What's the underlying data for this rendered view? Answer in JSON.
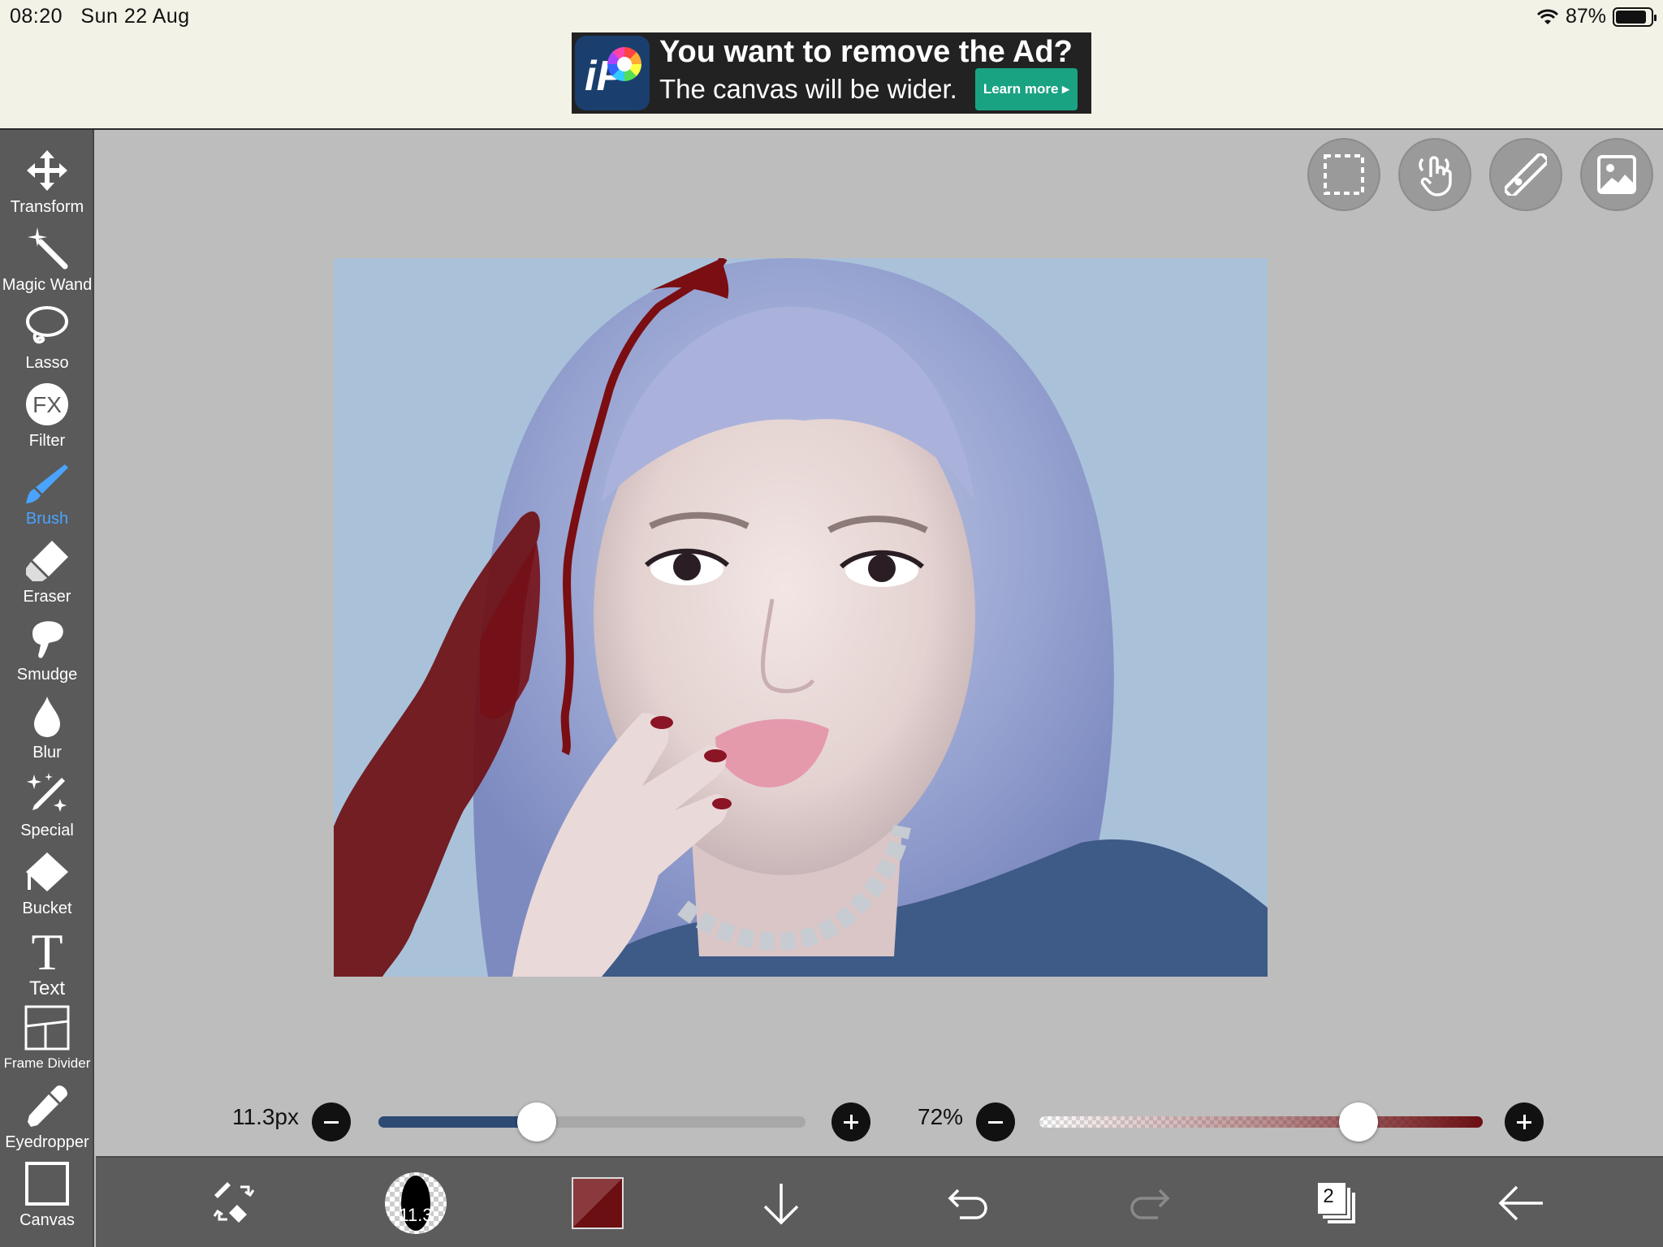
{
  "status": {
    "time": "08:20",
    "date": "Sun 22 Aug",
    "battery": "87%",
    "battery_level": 0.87
  },
  "ad": {
    "title": "You want to remove the Ad?",
    "subtitle": "The canvas will be wider.",
    "learn_more": "Learn more ▸",
    "logo_text": "iP"
  },
  "tools": [
    {
      "name": "transform",
      "label": "Transform",
      "icon": "move-arrows-icon"
    },
    {
      "name": "magic-wand",
      "label": "Magic Wand",
      "icon": "magic-wand-icon"
    },
    {
      "name": "lasso",
      "label": "Lasso",
      "icon": "lasso-icon"
    },
    {
      "name": "filter",
      "label": "Filter",
      "icon": "fx-icon"
    },
    {
      "name": "brush",
      "label": "Brush",
      "icon": "brush-icon",
      "active": true
    },
    {
      "name": "eraser",
      "label": "Eraser",
      "icon": "eraser-icon"
    },
    {
      "name": "smudge",
      "label": "Smudge",
      "icon": "smudge-icon"
    },
    {
      "name": "blur",
      "label": "Blur",
      "icon": "drop-icon"
    },
    {
      "name": "special",
      "label": "Special",
      "icon": "sparkle-pen-icon"
    },
    {
      "name": "bucket",
      "label": "Bucket",
      "icon": "bucket-icon"
    },
    {
      "name": "text",
      "label": "Text",
      "icon": "text-t-icon"
    },
    {
      "name": "frame-divider",
      "label": "Frame Divider",
      "icon": "frame-divider-icon"
    },
    {
      "name": "eyedropper",
      "label": "Eyedropper",
      "icon": "eyedropper-icon"
    },
    {
      "name": "canvas",
      "label": "Canvas",
      "icon": "canvas-square-icon"
    }
  ],
  "top_buttons": [
    "selection-icon",
    "gesture-hand-icon",
    "ruler-icon",
    "reference-image-icon"
  ],
  "brush_size": {
    "label": "11.3px",
    "value": 11.3,
    "fraction": 0.37
  },
  "opacity": {
    "label": "72%",
    "value": 72,
    "fraction": 0.72
  },
  "bottom": {
    "brush_preview_label": "11.3",
    "layer_count": "2",
    "primary_color": "#6b0f12"
  },
  "colors": {
    "accent": "#4aa3ff",
    "toolbar": "#5a5a5a",
    "blood": "#7a0e12"
  }
}
